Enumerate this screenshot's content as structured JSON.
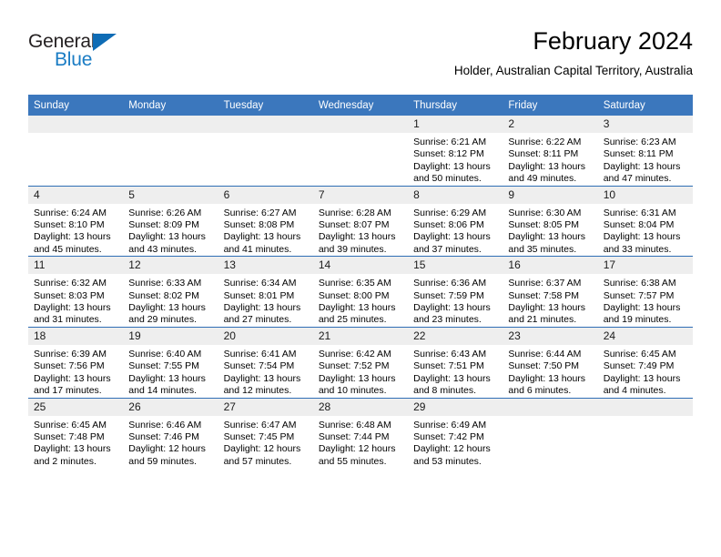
{
  "logo": {
    "word_one": "General",
    "word_two": "Blue",
    "triangle_color": "#0f6cb5",
    "blue_text_color": "#1a7cc4"
  },
  "header": {
    "title": "February 2024",
    "subtitle": "Holder, Australian Capital Territory, Australia"
  },
  "theme": {
    "header_blue": "#3b77bd",
    "row_divider_blue": "#2f6eb5",
    "daynum_band": "#eeeeee"
  },
  "calendar": {
    "weekday_headers": [
      "Sunday",
      "Monday",
      "Tuesday",
      "Wednesday",
      "Thursday",
      "Friday",
      "Saturday"
    ],
    "weeks": [
      [
        {
          "day": "",
          "sunrise": "",
          "sunset": "",
          "daylight_line1": "",
          "daylight_line2": ""
        },
        {
          "day": "",
          "sunrise": "",
          "sunset": "",
          "daylight_line1": "",
          "daylight_line2": ""
        },
        {
          "day": "",
          "sunrise": "",
          "sunset": "",
          "daylight_line1": "",
          "daylight_line2": ""
        },
        {
          "day": "",
          "sunrise": "",
          "sunset": "",
          "daylight_line1": "",
          "daylight_line2": ""
        },
        {
          "day": "1",
          "sunrise": "Sunrise: 6:21 AM",
          "sunset": "Sunset: 8:12 PM",
          "daylight_line1": "Daylight: 13 hours",
          "daylight_line2": "and 50 minutes."
        },
        {
          "day": "2",
          "sunrise": "Sunrise: 6:22 AM",
          "sunset": "Sunset: 8:11 PM",
          "daylight_line1": "Daylight: 13 hours",
          "daylight_line2": "and 49 minutes."
        },
        {
          "day": "3",
          "sunrise": "Sunrise: 6:23 AM",
          "sunset": "Sunset: 8:11 PM",
          "daylight_line1": "Daylight: 13 hours",
          "daylight_line2": "and 47 minutes."
        }
      ],
      [
        {
          "day": "4",
          "sunrise": "Sunrise: 6:24 AM",
          "sunset": "Sunset: 8:10 PM",
          "daylight_line1": "Daylight: 13 hours",
          "daylight_line2": "and 45 minutes."
        },
        {
          "day": "5",
          "sunrise": "Sunrise: 6:26 AM",
          "sunset": "Sunset: 8:09 PM",
          "daylight_line1": "Daylight: 13 hours",
          "daylight_line2": "and 43 minutes."
        },
        {
          "day": "6",
          "sunrise": "Sunrise: 6:27 AM",
          "sunset": "Sunset: 8:08 PM",
          "daylight_line1": "Daylight: 13 hours",
          "daylight_line2": "and 41 minutes."
        },
        {
          "day": "7",
          "sunrise": "Sunrise: 6:28 AM",
          "sunset": "Sunset: 8:07 PM",
          "daylight_line1": "Daylight: 13 hours",
          "daylight_line2": "and 39 minutes."
        },
        {
          "day": "8",
          "sunrise": "Sunrise: 6:29 AM",
          "sunset": "Sunset: 8:06 PM",
          "daylight_line1": "Daylight: 13 hours",
          "daylight_line2": "and 37 minutes."
        },
        {
          "day": "9",
          "sunrise": "Sunrise: 6:30 AM",
          "sunset": "Sunset: 8:05 PM",
          "daylight_line1": "Daylight: 13 hours",
          "daylight_line2": "and 35 minutes."
        },
        {
          "day": "10",
          "sunrise": "Sunrise: 6:31 AM",
          "sunset": "Sunset: 8:04 PM",
          "daylight_line1": "Daylight: 13 hours",
          "daylight_line2": "and 33 minutes."
        }
      ],
      [
        {
          "day": "11",
          "sunrise": "Sunrise: 6:32 AM",
          "sunset": "Sunset: 8:03 PM",
          "daylight_line1": "Daylight: 13 hours",
          "daylight_line2": "and 31 minutes."
        },
        {
          "day": "12",
          "sunrise": "Sunrise: 6:33 AM",
          "sunset": "Sunset: 8:02 PM",
          "daylight_line1": "Daylight: 13 hours",
          "daylight_line2": "and 29 minutes."
        },
        {
          "day": "13",
          "sunrise": "Sunrise: 6:34 AM",
          "sunset": "Sunset: 8:01 PM",
          "daylight_line1": "Daylight: 13 hours",
          "daylight_line2": "and 27 minutes."
        },
        {
          "day": "14",
          "sunrise": "Sunrise: 6:35 AM",
          "sunset": "Sunset: 8:00 PM",
          "daylight_line1": "Daylight: 13 hours",
          "daylight_line2": "and 25 minutes."
        },
        {
          "day": "15",
          "sunrise": "Sunrise: 6:36 AM",
          "sunset": "Sunset: 7:59 PM",
          "daylight_line1": "Daylight: 13 hours",
          "daylight_line2": "and 23 minutes."
        },
        {
          "day": "16",
          "sunrise": "Sunrise: 6:37 AM",
          "sunset": "Sunset: 7:58 PM",
          "daylight_line1": "Daylight: 13 hours",
          "daylight_line2": "and 21 minutes."
        },
        {
          "day": "17",
          "sunrise": "Sunrise: 6:38 AM",
          "sunset": "Sunset: 7:57 PM",
          "daylight_line1": "Daylight: 13 hours",
          "daylight_line2": "and 19 minutes."
        }
      ],
      [
        {
          "day": "18",
          "sunrise": "Sunrise: 6:39 AM",
          "sunset": "Sunset: 7:56 PM",
          "daylight_line1": "Daylight: 13 hours",
          "daylight_line2": "and 17 minutes."
        },
        {
          "day": "19",
          "sunrise": "Sunrise: 6:40 AM",
          "sunset": "Sunset: 7:55 PM",
          "daylight_line1": "Daylight: 13 hours",
          "daylight_line2": "and 14 minutes."
        },
        {
          "day": "20",
          "sunrise": "Sunrise: 6:41 AM",
          "sunset": "Sunset: 7:54 PM",
          "daylight_line1": "Daylight: 13 hours",
          "daylight_line2": "and 12 minutes."
        },
        {
          "day": "21",
          "sunrise": "Sunrise: 6:42 AM",
          "sunset": "Sunset: 7:52 PM",
          "daylight_line1": "Daylight: 13 hours",
          "daylight_line2": "and 10 minutes."
        },
        {
          "day": "22",
          "sunrise": "Sunrise: 6:43 AM",
          "sunset": "Sunset: 7:51 PM",
          "daylight_line1": "Daylight: 13 hours",
          "daylight_line2": "and 8 minutes."
        },
        {
          "day": "23",
          "sunrise": "Sunrise: 6:44 AM",
          "sunset": "Sunset: 7:50 PM",
          "daylight_line1": "Daylight: 13 hours",
          "daylight_line2": "and 6 minutes."
        },
        {
          "day": "24",
          "sunrise": "Sunrise: 6:45 AM",
          "sunset": "Sunset: 7:49 PM",
          "daylight_line1": "Daylight: 13 hours",
          "daylight_line2": "and 4 minutes."
        }
      ],
      [
        {
          "day": "25",
          "sunrise": "Sunrise: 6:45 AM",
          "sunset": "Sunset: 7:48 PM",
          "daylight_line1": "Daylight: 13 hours",
          "daylight_line2": "and 2 minutes."
        },
        {
          "day": "26",
          "sunrise": "Sunrise: 6:46 AM",
          "sunset": "Sunset: 7:46 PM",
          "daylight_line1": "Daylight: 12 hours",
          "daylight_line2": "and 59 minutes."
        },
        {
          "day": "27",
          "sunrise": "Sunrise: 6:47 AM",
          "sunset": "Sunset: 7:45 PM",
          "daylight_line1": "Daylight: 12 hours",
          "daylight_line2": "and 57 minutes."
        },
        {
          "day": "28",
          "sunrise": "Sunrise: 6:48 AM",
          "sunset": "Sunset: 7:44 PM",
          "daylight_line1": "Daylight: 12 hours",
          "daylight_line2": "and 55 minutes."
        },
        {
          "day": "29",
          "sunrise": "Sunrise: 6:49 AM",
          "sunset": "Sunset: 7:42 PM",
          "daylight_line1": "Daylight: 12 hours",
          "daylight_line2": "and 53 minutes."
        },
        {
          "day": "",
          "sunrise": "",
          "sunset": "",
          "daylight_line1": "",
          "daylight_line2": ""
        },
        {
          "day": "",
          "sunrise": "",
          "sunset": "",
          "daylight_line1": "",
          "daylight_line2": ""
        }
      ]
    ]
  }
}
